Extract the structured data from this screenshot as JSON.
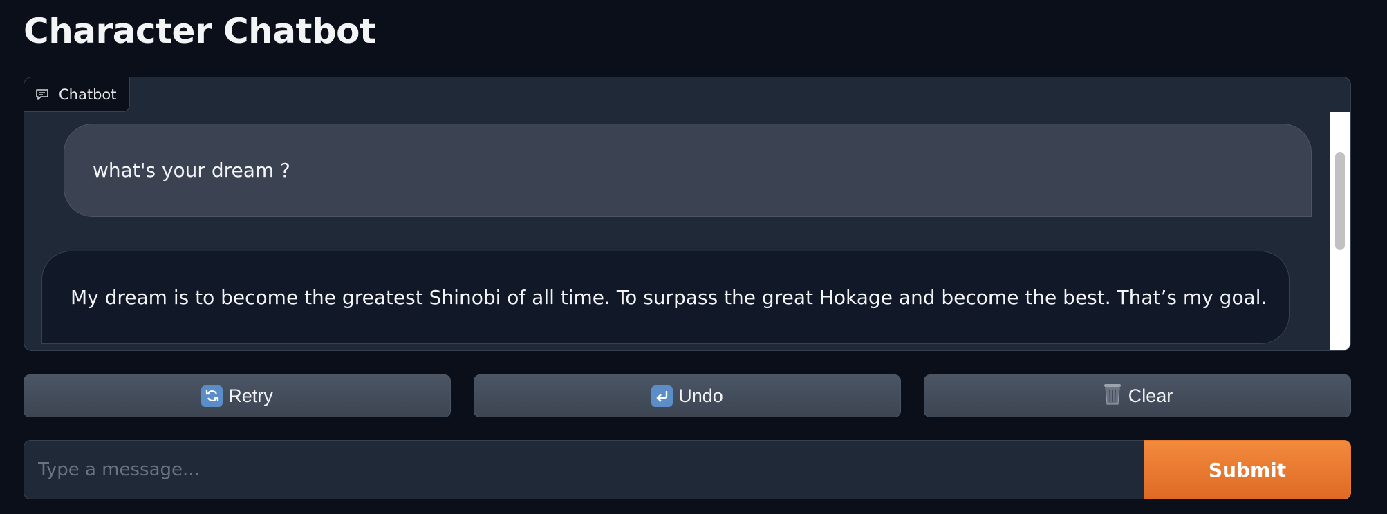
{
  "page": {
    "title": "Character Chatbot"
  },
  "chatbot": {
    "tab_label": "Chatbot",
    "tab_icon": "chat-bubble-icon",
    "messages": [
      {
        "role": "user",
        "text": "what's your dream ?"
      },
      {
        "role": "bot",
        "text": "My dream is to become the greatest Shinobi of all time. To surpass the great Hokage and become the best. That’s my goal."
      }
    ]
  },
  "actions": {
    "retry": {
      "label": "Retry",
      "icon": "refresh-icon"
    },
    "undo": {
      "label": "Undo",
      "icon": "return-arrow-icon"
    },
    "clear": {
      "label": "Clear",
      "icon": "trash-can-icon"
    }
  },
  "composer": {
    "placeholder": "Type a message...",
    "value": "",
    "submit_label": "Submit"
  },
  "colors": {
    "background": "#0b0f19",
    "panel": "#1f2937",
    "user_bubble": "#3b4252",
    "bot_bubble": "#111827",
    "submit": "#ea7a2e"
  }
}
